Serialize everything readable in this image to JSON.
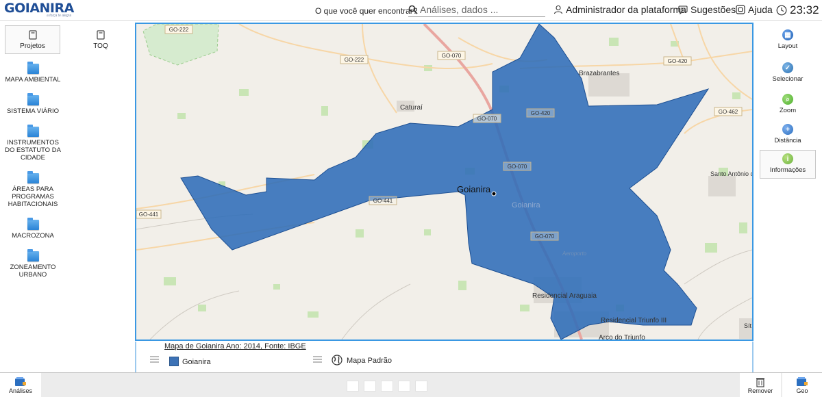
{
  "header": {
    "logo_text": "GOIANIRA",
    "logo_tagline": "a força te alegra",
    "search_prompt": "O que você quer encontrar?",
    "search_placeholder": "Análises, dados ...",
    "user_label": "Administrador da plataforma",
    "suggestions_label": "Sugestões",
    "help_label": "Ajuda",
    "clock": "23:32"
  },
  "left_sidebar": {
    "top_buttons": [
      {
        "label": "Projetos",
        "icon": "project-book-icon"
      },
      {
        "label": "TOQ",
        "icon": "toq-book-icon"
      }
    ],
    "categories": [
      {
        "label": "MAPA AMBIENTAL"
      },
      {
        "label": "SISTEMA VIÁRIO"
      },
      {
        "label": "INSTRUMENTOS DO ESTATUTO DA CIDADE"
      },
      {
        "label": "ÁREAS PARA PROGRAMAS HABITACIONAIS"
      },
      {
        "label": "MACROZONA"
      },
      {
        "label": "ZONEAMENTO URBANO"
      }
    ]
  },
  "map": {
    "road_labels": [
      "GO-222",
      "GO-222",
      "GO-070",
      "GO-420",
      "GO-462",
      "GO-070",
      "GO-420",
      "GO-070",
      "GO-441",
      "GO-441",
      "GO-070"
    ],
    "place_labels": [
      "Brazabrantes",
      "Caturaí",
      "Goianira",
      "Santo Antônio de Goiás",
      "Residencial Araguaia",
      "Residencial Triunfo III",
      "Arco do Triunfo",
      "Aeroporto",
      "Sít"
    ],
    "city_label": "Goianira",
    "polygon_color": "#2f6db8",
    "background_color": "#f2efe9"
  },
  "legend": {
    "title": "Mapa de Goianira Ano: 2014, Fonte: IBGE",
    "layer_label": "Goianira",
    "layer_color": "#3c72b6",
    "basemap_label": "Mapa Padrão"
  },
  "right_toolbar": {
    "tools": [
      {
        "label": "Layout",
        "icon": "layout-icon",
        "color": "#1e5fb3"
      },
      {
        "label": "Selecionar",
        "icon": "select-icon",
        "color": "#2a6fb0"
      },
      {
        "label": "Zoom",
        "icon": "zoom-icon",
        "color": "#4caf2a"
      },
      {
        "label": "Distância",
        "icon": "distance-icon",
        "color": "#2b6fc0"
      },
      {
        "label": "Informações",
        "icon": "info-icon",
        "color": "#6db33f"
      }
    ]
  },
  "bottom_bar": {
    "analyses_label": "Análises",
    "remove_label": "Remover",
    "geo_label": "Geo"
  }
}
